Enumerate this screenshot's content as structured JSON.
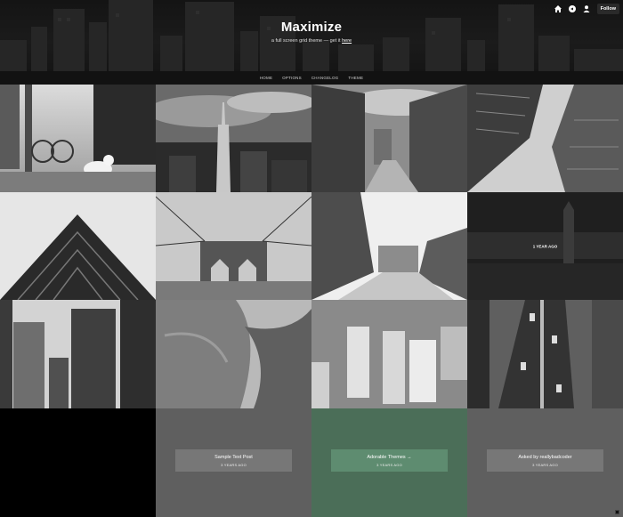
{
  "header": {
    "title": "Maximize",
    "description_prefix": "a full screen grid theme — get it ",
    "description_link": "here",
    "follow_label": "Follow",
    "icons": [
      "home-icon",
      "chat-icon",
      "user-icon"
    ]
  },
  "nav": {
    "items": [
      "HOME",
      "OPTIONS",
      "CHANGELOG",
      "THEME"
    ]
  },
  "grid": {
    "tiles": [
      {
        "name": "street-cat-photo"
      },
      {
        "name": "empire-state-photo"
      },
      {
        "name": "city-street-photo"
      },
      {
        "name": "skyscraper-lookup-photo"
      },
      {
        "name": "angular-building-photo"
      },
      {
        "name": "brooklyn-bridge-photo"
      },
      {
        "name": "avenue-photo"
      },
      {
        "name": "big-ben-photo",
        "label": "1 YEAR AGO"
      },
      {
        "name": "city-buildings-photo"
      },
      {
        "name": "curved-architecture-photo"
      },
      {
        "name": "aerial-city-photo"
      },
      {
        "name": "traffic-road-photo"
      }
    ],
    "posts": [
      {
        "title": "Sample Text Post",
        "date": "3 YEARS AGO"
      },
      {
        "title": "Adorable Themes →",
        "date": "3 YEARS AGO"
      },
      {
        "title": "Asked by reallybadcoder",
        "date": "3 YEARS AGO"
      }
    ]
  },
  "colors": {
    "header_bg": "#1b1b1b",
    "nav_bg": "#121212",
    "post_gray": "#5f5f5f",
    "post_green": "#4b6e58",
    "post_box_gray": "#777777",
    "post_box_green": "#5e8c70"
  }
}
